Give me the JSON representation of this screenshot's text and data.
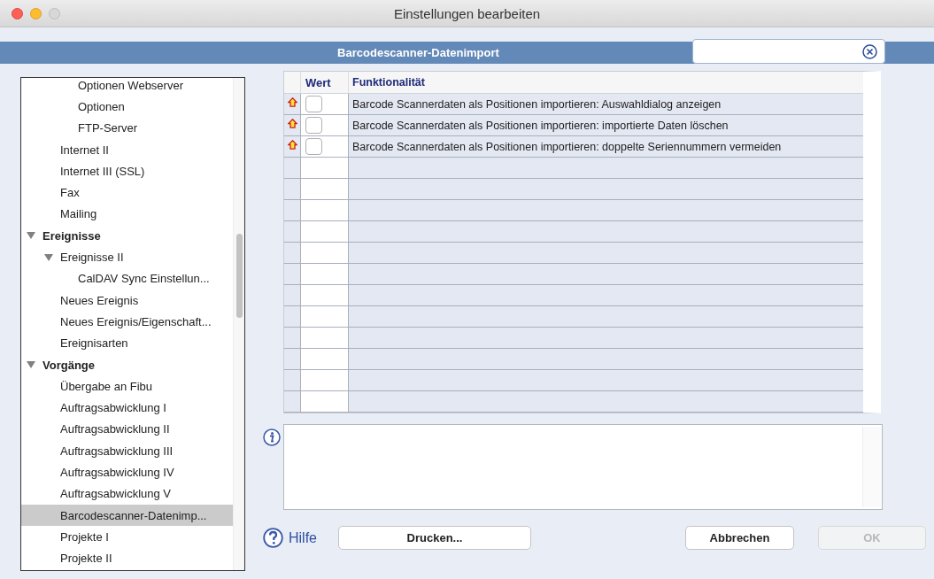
{
  "window": {
    "title": "Einstellungen bearbeiten"
  },
  "header": {
    "title": "Barcodescanner-Datenimport"
  },
  "tree": [
    {
      "children": [
        {
          "children": [
            {
              "label": "Optionen Webserver",
              "selected": false
            },
            {
              "label": "Optionen",
              "selected": false
            },
            {
              "label": "FTP-Server",
              "selected": false
            }
          ]
        },
        {
          "label": "Internet II",
          "selected": false
        },
        {
          "label": "Internet III (SSL)",
          "selected": false
        },
        {
          "label": "Fax",
          "selected": false
        },
        {
          "label": "Mailing",
          "selected": false
        }
      ]
    },
    {
      "label": "Ereignisse",
      "group": true,
      "expanded": true,
      "selected": false,
      "children": [
        {
          "label": "Ereignisse II",
          "expanded": true,
          "selected": false,
          "children": [
            {
              "label": "CalDAV Sync Einstellun...",
              "selected": false
            }
          ]
        },
        {
          "label": "Neues Ereignis",
          "selected": false
        },
        {
          "label": "Neues Ereignis/Eigenschaft...",
          "selected": false
        },
        {
          "label": "Ereignisarten",
          "selected": false
        }
      ]
    },
    {
      "label": "Vorgänge",
      "group": true,
      "expanded": true,
      "selected": false,
      "children": [
        {
          "label": "Übergabe an Fibu",
          "selected": false
        },
        {
          "label": "Auftragsabwicklung I",
          "selected": false
        },
        {
          "label": "Auftragsabwicklung II",
          "selected": false
        },
        {
          "label": "Auftragsabwicklung III",
          "selected": false
        },
        {
          "label": "Auftragsabwicklung IV",
          "selected": false
        },
        {
          "label": "Auftragsabwicklung V",
          "selected": false
        },
        {
          "label": "Barcodescanner-Datenimp...",
          "selected": true
        },
        {
          "label": "Projekte I",
          "selected": false
        },
        {
          "label": "Projekte II",
          "selected": false
        }
      ]
    }
  ],
  "table": {
    "columns": [
      "Wert",
      "Funktionalität"
    ],
    "rows": [
      {
        "checked": false,
        "text": "Barcode Scannerdaten als Positionen importieren: Auswahldialog anzeigen"
      },
      {
        "checked": false,
        "text": "Barcode Scannerdaten als Positionen importieren: importierte Daten löschen"
      },
      {
        "checked": false,
        "text": "Barcode Scannerdaten als Positionen importieren: doppelte Seriennummern vermeiden"
      }
    ]
  },
  "buttons": [
    {
      "kind": "help",
      "label": "Hilfe",
      "disabled": false
    },
    {
      "kind": "print",
      "label": "Drucken...",
      "disabled": false
    },
    {
      "kind": "cancel",
      "label": "Abbrechen",
      "disabled": false
    },
    {
      "kind": "ok",
      "label": "OK",
      "disabled": true
    }
  ]
}
